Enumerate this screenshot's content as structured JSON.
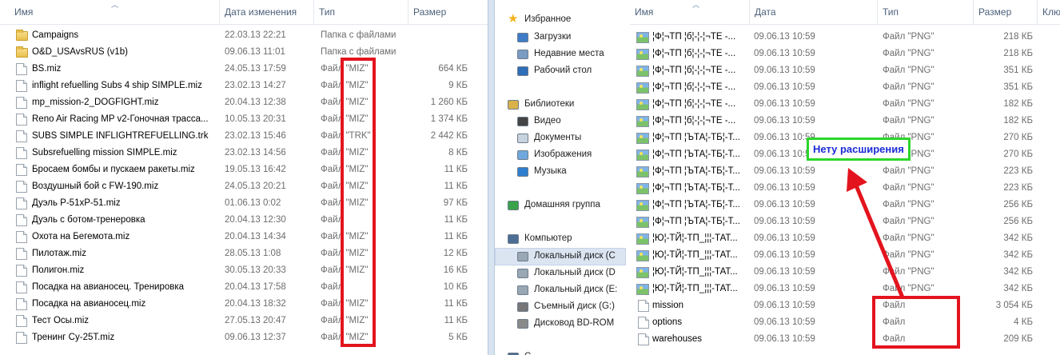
{
  "left_pane": {
    "columns": {
      "name": "Имя",
      "date": "Дата изменения",
      "type": "Тип",
      "size": "Размер"
    },
    "rows": [
      {
        "name": "Campaigns",
        "date": "22.03.13 22:21",
        "type": "Папка с файлами",
        "size": "",
        "icon": "folder-icon"
      },
      {
        "name": "O&D_USAvsRUS (v1b)",
        "date": "09.06.13 11:01",
        "type": "Папка с файлами",
        "size": "",
        "icon": "folder-icon"
      },
      {
        "name": "BS.miz",
        "date": "24.05.13 17:59",
        "type": "Файл \"MIZ\"",
        "size": "664 КБ",
        "icon": "file-icon"
      },
      {
        "name": "inflight refuelling Subs 4 ship SIMPLE.miz",
        "date": "23.02.13 14:27",
        "type": "Файл \"MIZ\"",
        "size": "9 КБ",
        "icon": "file-icon"
      },
      {
        "name": "mp_mission-2_DOGFIGHT.miz",
        "date": "20.04.13 12:38",
        "type": "Файл \"MIZ\"",
        "size": "1 260 КБ",
        "icon": "file-icon"
      },
      {
        "name": "Reno Air Racing MP v2-Гоночная трасса...",
        "date": "10.05.13 20:31",
        "type": "Файл \"MIZ\"",
        "size": "1 374 КБ",
        "icon": "file-icon"
      },
      {
        "name": "SUBS SIMPLE INFLIGHTREFUELLING.trk",
        "date": "23.02.13 15:46",
        "type": "Файл \"TRK\"",
        "size": "2 442 КБ",
        "icon": "file-icon"
      },
      {
        "name": "Subsrefuelling mission SIMPLE.miz",
        "date": "23.02.13 14:56",
        "type": "Файл \"MIZ\"",
        "size": "8 КБ",
        "icon": "file-icon"
      },
      {
        "name": "Бросаем бомбы и пускаем ракеты.miz",
        "date": "19.05.13 16:42",
        "type": "Файл \"MIZ\"",
        "size": "11 КБ",
        "icon": "file-icon"
      },
      {
        "name": "Воздушный бой с FW-190.miz",
        "date": "24.05.13 20:21",
        "type": "Файл \"MIZ\"",
        "size": "11 КБ",
        "icon": "file-icon"
      },
      {
        "name": "Дуэль P-51xP-51.miz",
        "date": "01.06.13 0:02",
        "type": "Файл \"MIZ\"",
        "size": "97 КБ",
        "icon": "file-icon"
      },
      {
        "name": "Дуэль с ботом-тренеровка",
        "date": "20.04.13 12:30",
        "type": "Файл",
        "size": "11 КБ",
        "icon": "file-icon"
      },
      {
        "name": "Охота на Бегемота.miz",
        "date": "20.04.13 14:34",
        "type": "Файл \"MIZ\"",
        "size": "11 КБ",
        "icon": "file-icon"
      },
      {
        "name": "Пилотаж.miz",
        "date": "28.05.13 1:08",
        "type": "Файл \"MIZ\"",
        "size": "12 КБ",
        "icon": "file-icon"
      },
      {
        "name": "Полигон.miz",
        "date": "30.05.13 20:33",
        "type": "Файл \"MIZ\"",
        "size": "16 КБ",
        "icon": "file-icon"
      },
      {
        "name": "Посадка на авианосец. Тренировка",
        "date": "20.04.13 17:58",
        "type": "Файл",
        "size": "10 КБ",
        "icon": "file-icon"
      },
      {
        "name": "Посадка на авианосец.miz",
        "date": "20.04.13 18:32",
        "type": "Файл \"MIZ\"",
        "size": "11 КБ",
        "icon": "file-icon"
      },
      {
        "name": "Тест Осы.miz",
        "date": "27.05.13 20:47",
        "type": "Файл \"MIZ\"",
        "size": "11 КБ",
        "icon": "file-icon"
      },
      {
        "name": "Тренинг Су-25Т.miz",
        "date": "09.06.13 12:37",
        "type": "Файл \"MIZ\"",
        "size": "5 КБ",
        "icon": "file-icon"
      }
    ]
  },
  "right_pane": {
    "columns": {
      "name": "Имя",
      "date": "Дата",
      "type": "Тип",
      "size": "Размер",
      "extra": "Клю"
    },
    "nav": [
      {
        "label": "Избранное",
        "icon": "star-icon"
      },
      {
        "label": "Загрузки",
        "icon": "downloads-icon"
      },
      {
        "label": "Недавние места",
        "icon": "recent-places-icon"
      },
      {
        "label": "Рабочий стол",
        "icon": "desktop-icon"
      },
      {
        "label": "Библиотеки",
        "icon": "libraries-icon"
      },
      {
        "label": "Видео",
        "icon": "video-icon"
      },
      {
        "label": "Документы",
        "icon": "documents-icon"
      },
      {
        "label": "Изображения",
        "icon": "pictures-icon"
      },
      {
        "label": "Музыка",
        "icon": "music-icon"
      },
      {
        "label": "Домашняя группа",
        "icon": "homegroup-icon"
      },
      {
        "label": "Компьютер",
        "icon": "computer-icon"
      },
      {
        "label": "Локальный диск (C",
        "icon": "drive-c-icon"
      },
      {
        "label": "Локальный диск (D",
        "icon": "drive-icon"
      },
      {
        "label": "Локальный диск (E:",
        "icon": "drive-icon"
      },
      {
        "label": "Съемный диск (G:)",
        "icon": "removable-drive-icon"
      },
      {
        "label": "Дисковод BD-ROM",
        "icon": "bd-rom-icon"
      },
      {
        "label": "С",
        "icon": "network-icon"
      }
    ],
    "rows": [
      {
        "name": "¦Ф¦¬ТП ¦б¦-¦-¦¬ТЕ -...",
        "date": "09.06.13 10:59",
        "type": "Файл \"PNG\"",
        "size": "218 КБ",
        "icon": "image-icon"
      },
      {
        "name": "¦Ф¦¬ТП ¦б¦-¦-¦¬ТЕ -...",
        "date": "09.06.13 10:59",
        "type": "Файл \"PNG\"",
        "size": "218 КБ",
        "icon": "image-icon"
      },
      {
        "name": "¦Ф¦¬ТП ¦б¦-¦-¦¬ТЕ -...",
        "date": "09.06.13 10:59",
        "type": "Файл \"PNG\"",
        "size": "351 КБ",
        "icon": "image-icon"
      },
      {
        "name": "¦Ф¦¬ТП ¦б¦-¦-¦¬ТЕ -...",
        "date": "09.06.13 10:59",
        "type": "Файл \"PNG\"",
        "size": "351 КБ",
        "icon": "image-icon"
      },
      {
        "name": "¦Ф¦¬ТП ¦б¦-¦-¦¬ТЕ -...",
        "date": "09.06.13 10:59",
        "type": "Файл \"PNG\"",
        "size": "182 КБ",
        "icon": "image-icon"
      },
      {
        "name": "¦Ф¦¬ТП ¦б¦-¦-¦¬ТЕ -...",
        "date": "09.06.13 10:59",
        "type": "Файл \"PNG\"",
        "size": "182 КБ",
        "icon": "image-icon"
      },
      {
        "name": "¦Ф¦¬ТП ¦ЪТА¦-ТБ¦-Т...",
        "date": "09.06.13 10:59",
        "type": "Файл \"PNG\"",
        "size": "270 КБ",
        "icon": "image-icon"
      },
      {
        "name": "¦Ф¦¬ТП ¦ЪТА¦-ТБ¦-Т...",
        "date": "09.06.13 10:59",
        "type": "Файл \"PNG\"",
        "size": "270 КБ",
        "icon": "image-icon"
      },
      {
        "name": "¦Ф¦¬ТП ¦ЪТА¦-ТБ¦-Т...",
        "date": "09.06.13 10:59",
        "type": "Файл \"PNG\"",
        "size": "223 КБ",
        "icon": "image-icon"
      },
      {
        "name": "¦Ф¦¬ТП ¦ЪТА¦-ТБ¦-Т...",
        "date": "09.06.13 10:59",
        "type": "Файл \"PNG\"",
        "size": "223 КБ",
        "icon": "image-icon"
      },
      {
        "name": "¦Ф¦¬ТП ¦ЪТА¦-ТБ¦-Т...",
        "date": "09.06.13 10:59",
        "type": "Файл \"PNG\"",
        "size": "256 КБ",
        "icon": "image-icon"
      },
      {
        "name": "¦Ф¦¬ТП ¦ЪТА¦-ТБ¦-Т...",
        "date": "09.06.13 10:59",
        "type": "Файл \"PNG\"",
        "size": "256 КБ",
        "icon": "image-icon"
      },
      {
        "name": "¦Ю¦-ТЙ¦-ТП_¦¦¦-ТАТ...",
        "date": "09.06.13 10:59",
        "type": "Файл \"PNG\"",
        "size": "342 КБ",
        "icon": "image-icon"
      },
      {
        "name": "¦Ю¦-ТЙ¦-ТП_¦¦¦-ТАТ...",
        "date": "09.06.13 10:59",
        "type": "Файл \"PNG\"",
        "size": "342 КБ",
        "icon": "image-icon"
      },
      {
        "name": "¦Ю¦-ТЙ¦-ТП_¦¦¦-ТАТ...",
        "date": "09.06.13 10:59",
        "type": "Файл \"PNG\"",
        "size": "342 КБ",
        "icon": "image-icon"
      },
      {
        "name": "¦Ю¦-ТЙ¦-ТП_¦¦¦-ТАТ...",
        "date": "09.06.13 10:59",
        "type": "Файл \"PNG\"",
        "size": "342 КБ",
        "icon": "image-icon"
      },
      {
        "name": "mission",
        "date": "09.06.13 10:59",
        "type": "Файл",
        "size": "3 054 КБ",
        "icon": "file-icon"
      },
      {
        "name": "options",
        "date": "09.06.13 10:59",
        "type": "Файл",
        "size": "4 КБ",
        "icon": "file-icon"
      },
      {
        "name": "warehouses",
        "date": "09.06.13 10:59",
        "type": "Файл",
        "size": "209 КБ",
        "icon": "file-icon"
      }
    ],
    "annotation": "Нету расширения"
  },
  "colors": {
    "highlight": "#e3141e",
    "annotation_border": "#2bd62b",
    "annotation_text": "#1a2bd6"
  }
}
